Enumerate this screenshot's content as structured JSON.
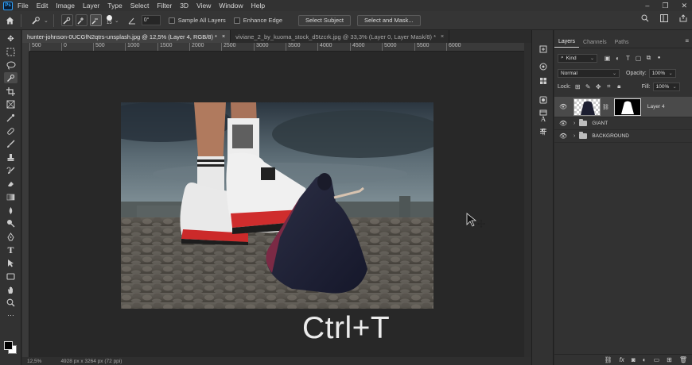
{
  "app": {
    "logo": "Ps"
  },
  "menu": [
    "File",
    "Edit",
    "Image",
    "Layer",
    "Type",
    "Select",
    "Filter",
    "3D",
    "View",
    "Window",
    "Help"
  ],
  "window_controls": {
    "minimize": "–",
    "maximize": "❐",
    "close": "✕"
  },
  "options": {
    "brush_size": "15",
    "angle": "0°",
    "sample_all_layers": "Sample All Layers",
    "enhance_edge": "Enhance Edge",
    "select_subject": "Select Subject",
    "select_and_mask": "Select and Mask..."
  },
  "tabs": [
    {
      "label": "hunter-johnson-0UCGfN2qtrs-unsplash.jpg @ 12,5% (Layer 4, RGB/8) *",
      "close": "×"
    },
    {
      "label": "viviane_2_by_kuoma_stock_d5tzcrk.jpg @ 33,3% (Layer 0, Layer Mask/8) *",
      "close": "×"
    }
  ],
  "ruler_ticks": [
    "500",
    "0",
    "500",
    "1000",
    "1500",
    "2000",
    "2500",
    "3000",
    "3500",
    "4000",
    "4500",
    "5000",
    "5500",
    "6000"
  ],
  "overlay_text": "Ctrl+T",
  "status": {
    "zoom": "12,5%",
    "doc_size": "4928 px x 3264 px (72 ppi)"
  },
  "layers_panel": {
    "tabs": [
      "Layers",
      "Channels",
      "Paths"
    ],
    "filter": "Kind",
    "blend_mode": "Normal",
    "opacity_label": "Opacity:",
    "opacity_value": "100%",
    "lock_label": "Lock:",
    "fill_label": "Fill:",
    "fill_value": "100%",
    "layers": [
      {
        "name": "Layer 4",
        "selected": true
      },
      {
        "name": "GIANT"
      },
      {
        "name": "BACKGROUND"
      }
    ]
  },
  "colors": {
    "accent": "#31a8ff",
    "canvas_bg": "#282828",
    "panel_bg": "#323232"
  }
}
